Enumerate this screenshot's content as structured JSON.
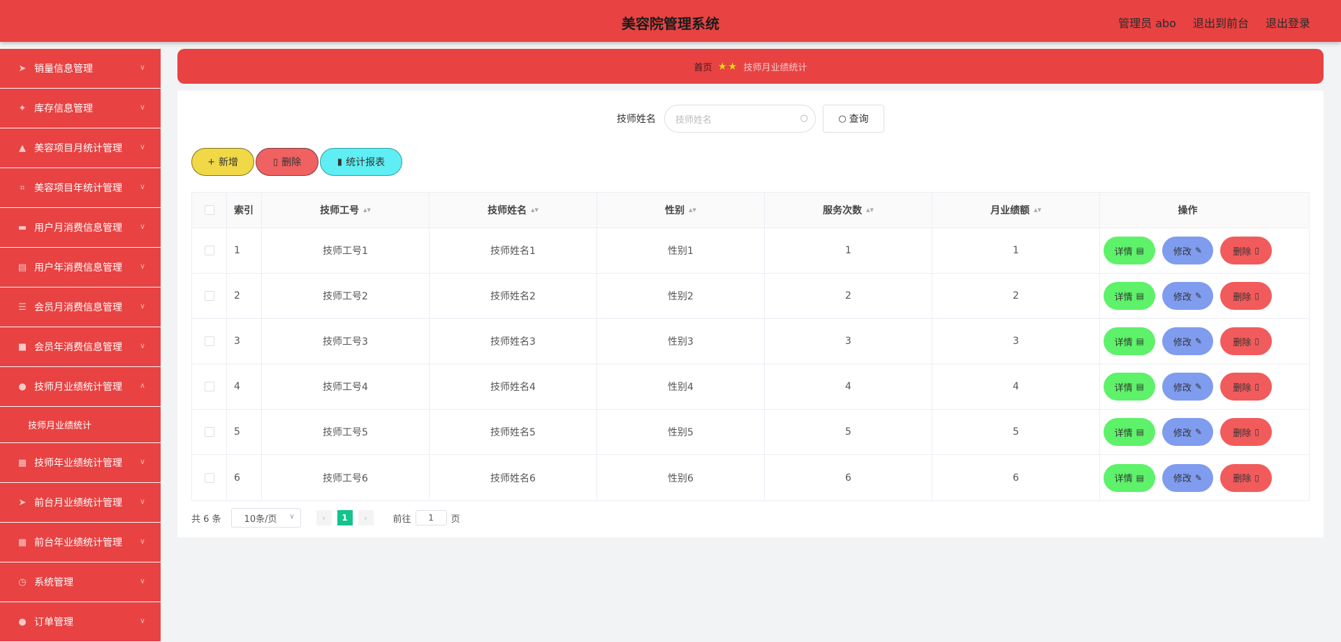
{
  "header": {
    "title": "美容院管理系统",
    "user_label": "管理员 abo",
    "to_frontend": "退出到前台",
    "logout": "退出登录"
  },
  "sidebar": {
    "items": [
      {
        "label": "销量信息管理",
        "icon": "send-icon",
        "glyph": "➤"
      },
      {
        "label": "库存信息管理",
        "icon": "compass-icon",
        "glyph": "✦"
      },
      {
        "label": "美容项目月统计管理",
        "icon": "thumb-icon",
        "glyph": "▲"
      },
      {
        "label": "美容项目年统计管理",
        "icon": "crop-icon",
        "glyph": "⌗"
      },
      {
        "label": "用户月消费信息管理",
        "icon": "ticket-icon",
        "glyph": "▬"
      },
      {
        "label": "用户年消费信息管理",
        "icon": "document-icon",
        "glyph": "▤"
      },
      {
        "label": "会员月消费信息管理",
        "icon": "sliders-icon",
        "glyph": "☰"
      },
      {
        "label": "会员年消费信息管理",
        "icon": "message-icon",
        "glyph": "■"
      },
      {
        "label": "技师月业绩统计管理",
        "icon": "user-icon",
        "glyph": "●",
        "expanded": true,
        "sub": "技师月业绩统计"
      },
      {
        "label": "技师年业绩统计管理",
        "icon": "chart-icon",
        "glyph": "▦"
      },
      {
        "label": "前台月业绩统计管理",
        "icon": "send-icon",
        "glyph": "➤"
      },
      {
        "label": "前台年业绩统计管理",
        "icon": "grid-icon",
        "glyph": "▦"
      },
      {
        "label": "系统管理",
        "icon": "clock-icon",
        "glyph": "◷"
      },
      {
        "label": "订单管理",
        "icon": "location-icon",
        "glyph": "●"
      }
    ]
  },
  "breadcrumb": {
    "home": "首页",
    "current": "技师月业绩统计"
  },
  "search": {
    "label": "技师姓名",
    "placeholder": "技师姓名",
    "button": "查询"
  },
  "actions": {
    "add": "新增",
    "delete": "删除",
    "report": "统计报表"
  },
  "table": {
    "headers": {
      "index": "索引",
      "tech_no": "技师工号",
      "tech_name": "技师姓名",
      "gender": "性别",
      "service_count": "服务次数",
      "monthly": "月业绩额",
      "ops": "操作"
    },
    "rows": [
      {
        "index": "1",
        "tech_no": "技师工号1",
        "tech_name": "技师姓名1",
        "gender": "性别1",
        "service_count": "1",
        "monthly": "1"
      },
      {
        "index": "2",
        "tech_no": "技师工号2",
        "tech_name": "技师姓名2",
        "gender": "性别2",
        "service_count": "2",
        "monthly": "2"
      },
      {
        "index": "3",
        "tech_no": "技师工号3",
        "tech_name": "技师姓名3",
        "gender": "性别3",
        "service_count": "3",
        "monthly": "3"
      },
      {
        "index": "4",
        "tech_no": "技师工号4",
        "tech_name": "技师姓名4",
        "gender": "性别4",
        "service_count": "4",
        "monthly": "4"
      },
      {
        "index": "5",
        "tech_no": "技师工号5",
        "tech_name": "技师姓名5",
        "gender": "性别5",
        "service_count": "5",
        "monthly": "5"
      },
      {
        "index": "6",
        "tech_no": "技师工号6",
        "tech_name": "技师姓名6",
        "gender": "性别6",
        "service_count": "6",
        "monthly": "6"
      }
    ],
    "op_labels": {
      "detail": "详情",
      "edit": "修改",
      "delete": "删除"
    }
  },
  "pager": {
    "total": "共 6 条",
    "page_size": "10条/页",
    "current_page": "1",
    "goto_prefix": "前往",
    "goto_value": "1",
    "goto_suffix": "页"
  },
  "colors": {
    "primary_red": "#e84242",
    "detail_green": "#5ef16a",
    "edit_blue": "#7f9cef",
    "delete_red": "#f25b5b",
    "page_active": "#13c38b"
  }
}
